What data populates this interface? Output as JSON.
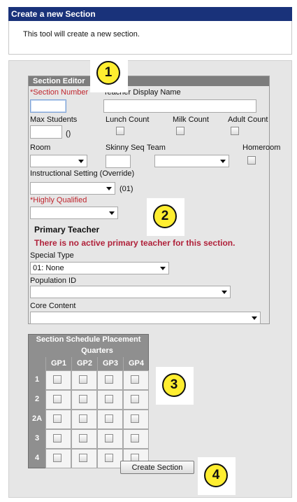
{
  "header": {
    "title": "Create a new Section",
    "description": "This tool will create a new section."
  },
  "editor": {
    "title": "Section Editor",
    "section_number_label": "*Section Number",
    "teacher_display_name_label": "Teacher Display Name",
    "max_students_label": "Max Students",
    "max_students_hint": "()",
    "lunch_count_label": "Lunch Count",
    "milk_count_label": "Milk Count",
    "adult_count_label": "Adult Count",
    "room_label": "Room",
    "skinny_seq_label": "Skinny Seq",
    "team_label": "Team",
    "homeroom_label": "Homeroom",
    "instructional_setting_label": "Instructional Setting (Override)",
    "instructional_setting_hint": "(01)",
    "highly_qualified_label": "*Highly Qualified",
    "primary_teacher_label": "Primary Teacher",
    "no_teacher_warning": "There is no active primary teacher for this section.",
    "special_type_label": "Special Type",
    "special_type_value": "01: None",
    "population_id_label": "Population ID",
    "core_content_label": "Core Content"
  },
  "schedule": {
    "title": "Section Schedule Placement",
    "subtitle": "Quarters",
    "terms": [
      "GP1",
      "GP2",
      "GP3",
      "GP4"
    ],
    "periods": [
      "1",
      "2",
      "2A",
      "3",
      "4"
    ]
  },
  "actions": {
    "create_label": "Create Section"
  },
  "callouts": [
    "1",
    "2",
    "3",
    "4"
  ],
  "colors": {
    "header_bg": "#19327a",
    "panel_bg": "#e6e6e6",
    "required_text": "#c0262e",
    "callout_fill": "#ffee30"
  }
}
